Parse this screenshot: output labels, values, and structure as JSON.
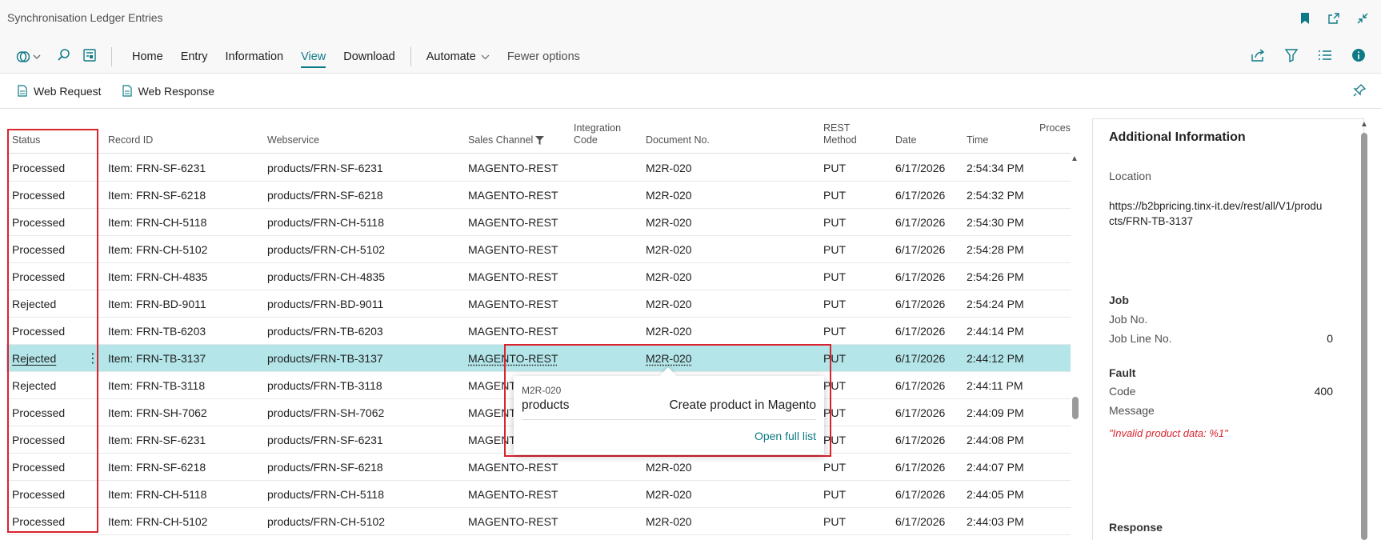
{
  "window": {
    "title": "Synchronisation Ledger Entries"
  },
  "title_icons": [
    "bookmark-icon",
    "open-new-window-icon",
    "collapse-icon"
  ],
  "actionbar": {
    "menu": [
      "Home",
      "Entry",
      "Information",
      "View",
      "Download"
    ],
    "active": "View",
    "automate": "Automate",
    "fewer": "Fewer options"
  },
  "subbar": {
    "web_request": "Web Request",
    "web_response": "Web Response"
  },
  "columns": {
    "status": "Status",
    "record_id": "Record ID",
    "webservice": "Webservice",
    "sales_channel": "Sales Channel",
    "integration_code_1": "Integration",
    "integration_code_2": "Code",
    "document_no": "Document No.",
    "rest_method_1": "REST",
    "rest_method_2": "Method",
    "date": "Date",
    "time": "Time",
    "processing": "Processing"
  },
  "rows": [
    {
      "status": "Processed",
      "record": "Item: FRN-SF-6231",
      "ws": "products/FRN-SF-6231",
      "channel": "MAGENTO-REST",
      "doc": "M2R-020",
      "method": "PUT",
      "date": "6/17/2026",
      "time": "2:54:34 PM"
    },
    {
      "status": "Processed",
      "record": "Item: FRN-SF-6218",
      "ws": "products/FRN-SF-6218",
      "channel": "MAGENTO-REST",
      "doc": "M2R-020",
      "method": "PUT",
      "date": "6/17/2026",
      "time": "2:54:32 PM"
    },
    {
      "status": "Processed",
      "record": "Item: FRN-CH-5118",
      "ws": "products/FRN-CH-5118",
      "channel": "MAGENTO-REST",
      "doc": "M2R-020",
      "method": "PUT",
      "date": "6/17/2026",
      "time": "2:54:30 PM"
    },
    {
      "status": "Processed",
      "record": "Item: FRN-CH-5102",
      "ws": "products/FRN-CH-5102",
      "channel": "MAGENTO-REST",
      "doc": "M2R-020",
      "method": "PUT",
      "date": "6/17/2026",
      "time": "2:54:28 PM"
    },
    {
      "status": "Processed",
      "record": "Item: FRN-CH-4835",
      "ws": "products/FRN-CH-4835",
      "channel": "MAGENTO-REST",
      "doc": "M2R-020",
      "method": "PUT",
      "date": "6/17/2026",
      "time": "2:54:26 PM"
    },
    {
      "status": "Rejected",
      "record": "Item: FRN-BD-9011",
      "ws": "products/FRN-BD-9011",
      "channel": "MAGENTO-REST",
      "doc": "M2R-020",
      "method": "PUT",
      "date": "6/17/2026",
      "time": "2:54:24 PM"
    },
    {
      "status": "Processed",
      "record": "Item: FRN-TB-6203",
      "ws": "products/FRN-TB-6203",
      "channel": "MAGENTO-REST",
      "doc": "M2R-020",
      "method": "PUT",
      "date": "6/17/2026",
      "time": "2:44:14 PM"
    },
    {
      "status": "Rejected",
      "record": "Item: FRN-TB-3137",
      "ws": "products/FRN-TB-3137",
      "channel": "MAGENTO-REST",
      "doc": "M2R-020",
      "method": "PUT",
      "date": "6/17/2026",
      "time": "2:44:12 PM"
    },
    {
      "status": "Rejected",
      "record": "Item: FRN-TB-3118",
      "ws": "products/FRN-TB-3118",
      "channel": "MAGENT",
      "doc": "",
      "method": "PUT",
      "date": "6/17/2026",
      "time": "2:44:11 PM"
    },
    {
      "status": "Processed",
      "record": "Item: FRN-SH-7062",
      "ws": "products/FRN-SH-7062",
      "channel": "MAGENT",
      "doc": "",
      "method": "PUT",
      "date": "6/17/2026",
      "time": "2:44:09 PM"
    },
    {
      "status": "Processed",
      "record": "Item: FRN-SF-6231",
      "ws": "products/FRN-SF-6231",
      "channel": "MAGENT",
      "doc": "",
      "method": "PUT",
      "date": "6/17/2026",
      "time": "2:44:08 PM"
    },
    {
      "status": "Processed",
      "record": "Item: FRN-SF-6218",
      "ws": "products/FRN-SF-6218",
      "channel": "MAGENTO-REST",
      "doc": "M2R-020",
      "method": "PUT",
      "date": "6/17/2026",
      "time": "2:44:07 PM"
    },
    {
      "status": "Processed",
      "record": "Item: FRN-CH-5118",
      "ws": "products/FRN-CH-5118",
      "channel": "MAGENTO-REST",
      "doc": "M2R-020",
      "method": "PUT",
      "date": "6/17/2026",
      "time": "2:44:05 PM"
    },
    {
      "status": "Processed",
      "record": "Item: FRN-CH-5102",
      "ws": "products/FRN-CH-5102",
      "channel": "MAGENTO-REST",
      "doc": "M2R-020",
      "method": "PUT",
      "date": "6/17/2026",
      "time": "2:44:03 PM"
    }
  ],
  "selected_row": 7,
  "popup": {
    "code": "M2R-020",
    "name": "products",
    "description": "Create product in Magento",
    "link": "Open full list"
  },
  "panel": {
    "title": "Additional Information",
    "location_label": "Location",
    "location_value": "https://b2bpricing.tinx-it.dev/rest/all/V1/products/FRN-TB-3137",
    "job_head": "Job",
    "job_no_label": "Job No.",
    "job_line_label": "Job Line No.",
    "job_line_value": "0",
    "fault_head": "Fault",
    "code_label": "Code",
    "code_value": "400",
    "message_label": "Message",
    "message_value": "\"Invalid product data: %1\"",
    "response_head": "Response"
  },
  "colors": {
    "accent": "#0e7a85",
    "selected_row": "#b3e5e9",
    "highlight": "#d9232e"
  }
}
